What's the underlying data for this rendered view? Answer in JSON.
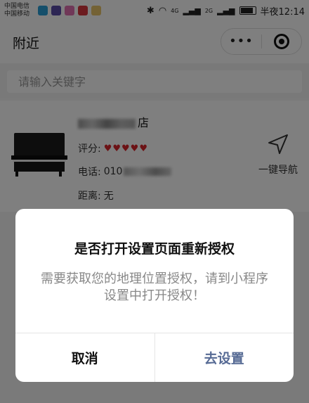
{
  "status": {
    "carrier1": "中国电信",
    "carrier2": "中国移动",
    "net1": "4G",
    "net2": "2G",
    "time": "半夜12:14"
  },
  "nav": {
    "title": "附近",
    "more": "•••"
  },
  "search": {
    "placeholder": "请输入关键字"
  },
  "shop": {
    "name_suffix": "店",
    "rating_label": "评分:",
    "rating_hearts": "♥♥♥♥♥",
    "phone_label": "电话:",
    "phone_prefix": "010",
    "distance_label": "距离:",
    "distance_value": "无",
    "navigate_label": "一键导航"
  },
  "dialog": {
    "title": "是否打开设置页面重新授权",
    "message": "需要获取您的地理位置授权，请到小程序设置中打开授权！",
    "cancel": "取消",
    "confirm": "去设置"
  },
  "colors": {
    "heart": "#d9252b",
    "confirm": "#576b95"
  }
}
